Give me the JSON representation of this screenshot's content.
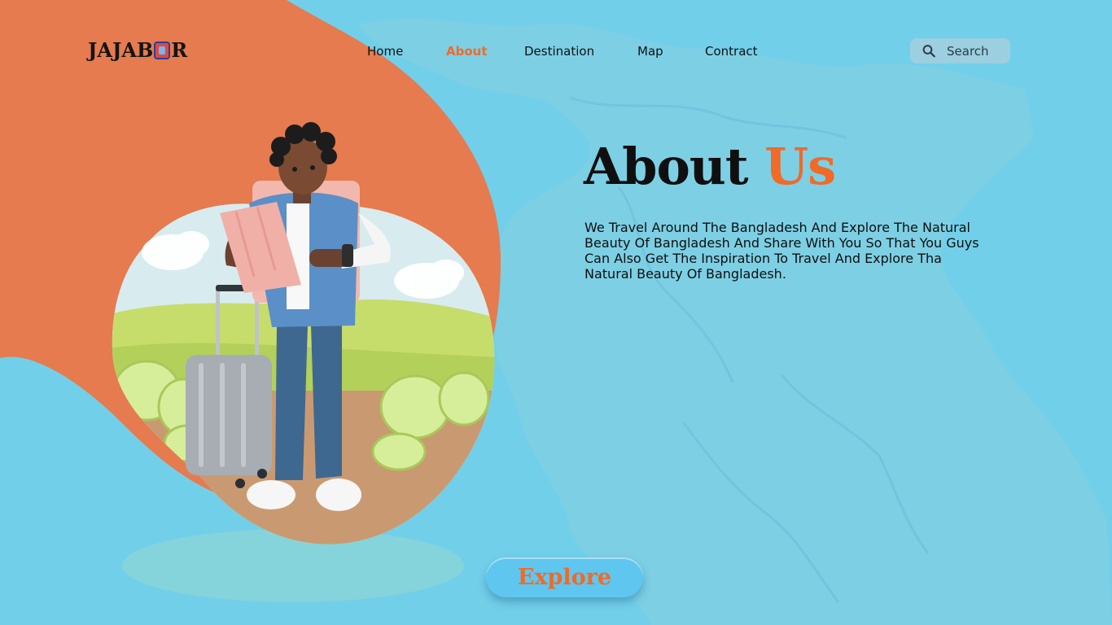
{
  "brand": {
    "logo_text_left": "JAJAB",
    "logo_text_right": "R"
  },
  "nav": {
    "items": [
      {
        "label": "Home",
        "active": false
      },
      {
        "label": "About",
        "active": true
      },
      {
        "label": "Destination",
        "active": false
      },
      {
        "label": "Map",
        "active": false
      },
      {
        "label": "Contract",
        "active": false
      }
    ]
  },
  "search": {
    "placeholder": "Search",
    "icon": "search-icon"
  },
  "hero": {
    "title_main": "About",
    "title_accent": "Us",
    "body": "We Travel Around The Bangladesh And Explore The Natural Beauty Of Bangladesh And Share With You So That You Guys Can Also Get The Inspiration To Travel And Explore Tha Natural Beauty Of Bangladesh."
  },
  "cta": {
    "label": "Explore"
  },
  "colors": {
    "background": "#72cfe9",
    "accent": "#f06a28",
    "blob": "#e57b4f",
    "map_overlay": "#8ed2e4",
    "text": "#0f0f0f"
  }
}
